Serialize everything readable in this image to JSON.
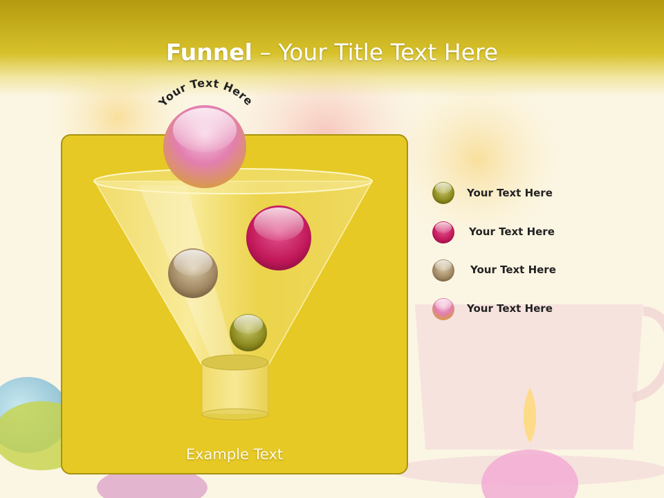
{
  "title": {
    "bold": "Funnel",
    "separator": " – ",
    "rest": "Your Title Text Here"
  },
  "arc_text": "Your Text Here",
  "example_text": "Example Text",
  "legend": [
    {
      "label": "Your  Text Here",
      "color": "#8c8a1c"
    },
    {
      "label": "Your  Text Here",
      "color": "#c81a62"
    },
    {
      "label": "Your  Text Here",
      "color": "#9a8f3a"
    },
    {
      "label": "Your  Text Here",
      "color": "#e080a0"
    }
  ],
  "colors": {
    "title_bar": "#c9b21f",
    "panel": "#e6c925",
    "panel_border": "#a7930f",
    "ball_pink": "#e070b0",
    "ball_magenta": "#c81a62",
    "ball_olive": "#8c8a1c",
    "ball_taupe": "#9a7c5a"
  }
}
